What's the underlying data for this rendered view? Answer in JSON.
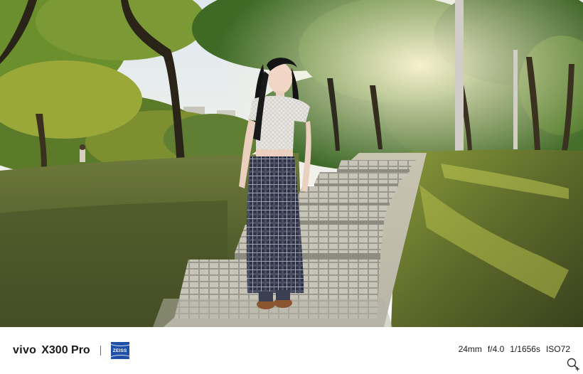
{
  "caption": {
    "brand": "vivo",
    "model": "X300 Pro",
    "lens_badge": "ZEISS",
    "focal_length": "24mm",
    "aperture": "f/4.0",
    "shutter": "1/1656s",
    "iso": "ISO72"
  },
  "icons": {
    "zoom": "magnifier-plus-icon"
  },
  "colors": {
    "caption_background": "#ffffff",
    "caption_text": "#1a1a1a",
    "zeiss_blue": "#1f4fa6"
  }
}
